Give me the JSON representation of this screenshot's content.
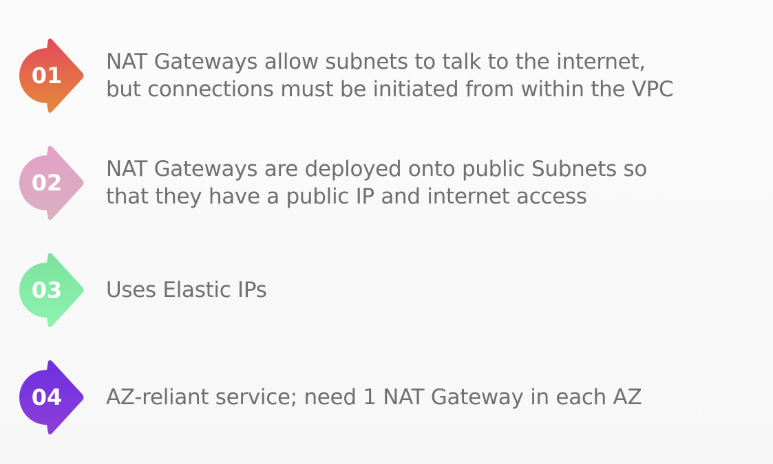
{
  "items": [
    {
      "number": "01",
      "lines": [
        "NAT Gateways allow subnets to talk to the internet,",
        "but connections must be initiated from within the VPC"
      ],
      "colors": [
        "#e24a5a",
        "#e68a3a"
      ]
    },
    {
      "number": "02",
      "lines": [
        "NAT Gateways are deployed onto public Subnets so",
        "that they have a public IP and internet access"
      ],
      "colors": [
        "#e3a0c6",
        "#d9b0c0"
      ]
    },
    {
      "number": "03",
      "lines": [
        "Uses Elastic IPs"
      ],
      "colors": [
        "#7ae39c",
        "#8ff2b0"
      ]
    },
    {
      "number": "04",
      "lines": [
        "AZ-reliant service; need 1 NAT Gateway in each AZ"
      ],
      "colors": [
        "#6d2fe0",
        "#8c3fd8"
      ]
    }
  ]
}
